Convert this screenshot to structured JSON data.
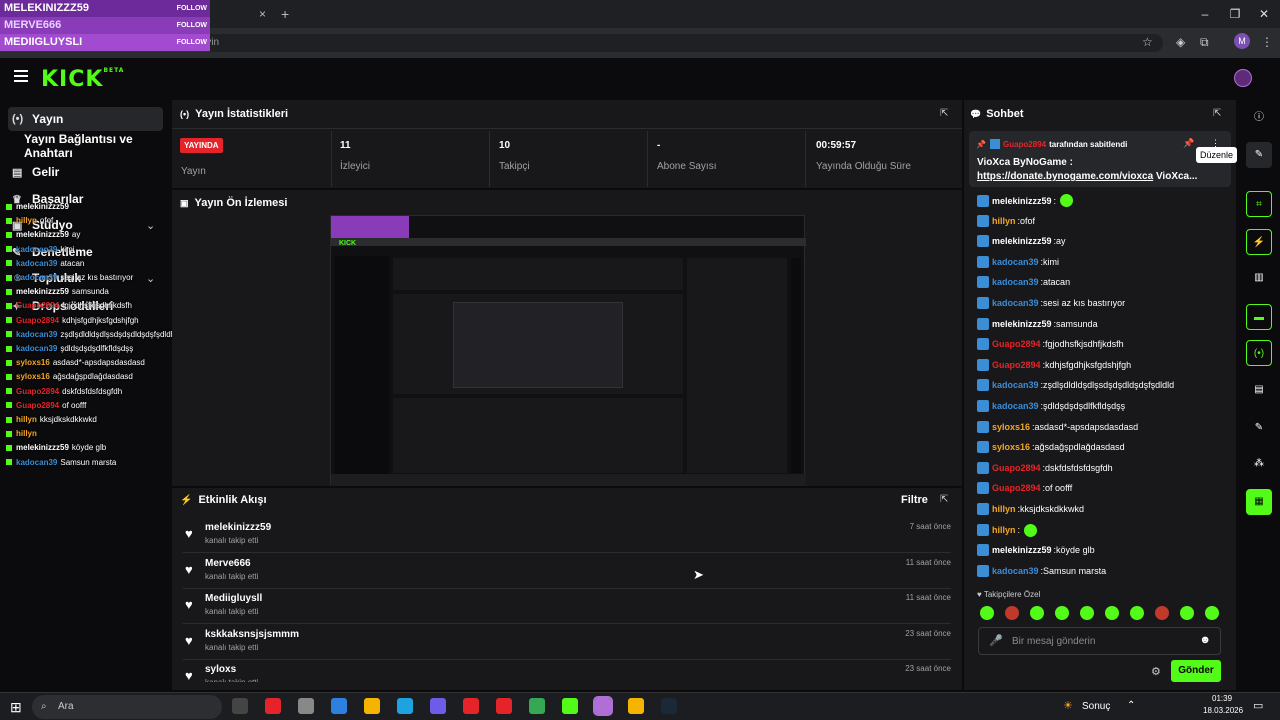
{
  "browser": {
    "url": "dashboard.kick.com/yayin",
    "tab_close": "×",
    "new_tab": "+",
    "profile_initial": "M"
  },
  "follow_alert": {
    "lines": [
      "MELEKINIZZZ59",
      "MERVE666",
      "MEDIIGLUYSLI"
    ],
    "follow_label": "FOLLOW"
  },
  "kick": {
    "logo": "KICK",
    "beta": "BETA",
    "brand_color": "#53fc18"
  },
  "sidebar": {
    "items": [
      {
        "label": "Yayın",
        "icon": "broadcast-icon"
      },
      {
        "label": "Yayın Bağlantısı ve Anahtarı",
        "icon": ""
      },
      {
        "label": "Gelir",
        "icon": "dollar-icon"
      },
      {
        "label": "Başarılar",
        "icon": "trophy-icon"
      },
      {
        "label": "Stüdyo",
        "icon": "studio-icon"
      },
      {
        "label": "Denetleme",
        "icon": "wrench-icon"
      },
      {
        "label": "Topluluk",
        "icon": "community-icon"
      },
      {
        "label": "Drops ödülleri",
        "icon": "gift-icon"
      }
    ]
  },
  "overlay_chat": [
    {
      "user": "melekinizzz59",
      "msg": "",
      "color": "#ffffff"
    },
    {
      "user": "hillyn",
      "msg": "ofof",
      "color": "#f5a623"
    },
    {
      "user": "melekinizzz59",
      "msg": "ay",
      "color": "#ffffff"
    },
    {
      "user": "kadocan39",
      "msg": "kimi",
      "color": "#3b8dd6"
    },
    {
      "user": "kadocan39",
      "msg": "atacan",
      "color": "#3b8dd6"
    },
    {
      "user": "kadocan39",
      "msg": "sesi az kıs bastırıyor",
      "color": "#3b8dd6"
    },
    {
      "user": "melekinizzz59",
      "msg": "samsunda",
      "color": "#ffffff"
    },
    {
      "user": "Guapo2894",
      "msg": "fgjodhsfkjsdhfjkdsfh",
      "color": "#e5242a"
    },
    {
      "user": "Guapo2894",
      "msg": "kdhjsfgdhjksfgdshjfgh",
      "color": "#e5242a"
    },
    {
      "user": "kadocan39",
      "msg": "zşdlşdldldşdlşsdşdşdldşdşfşdldld",
      "color": "#3b8dd6"
    },
    {
      "user": "kadocan39",
      "msg": "şdldşdşdşdlfkfldşdşş",
      "color": "#3b8dd6"
    },
    {
      "user": "syloxs16",
      "msg": "asdasd*-apsdapsdasdasd",
      "color": "#f5a623"
    },
    {
      "user": "syloxs16",
      "msg": "ağsdağşpdlağdasdasd",
      "color": "#f5a623"
    },
    {
      "user": "Guapo2894",
      "msg": "dskfdsfdsfdsgfdh",
      "color": "#e5242a"
    },
    {
      "user": "Guapo2894",
      "msg": "of oofff",
      "color": "#e5242a"
    },
    {
      "user": "hillyn",
      "msg": "kksjdkskdkkwkd",
      "color": "#f5a623"
    },
    {
      "user": "hillyn",
      "msg": "",
      "color": "#f5a623"
    },
    {
      "user": "melekinizzz59",
      "msg": "köyde glb",
      "color": "#ffffff"
    },
    {
      "user": "kadocan39",
      "msg": "Samsun marsta",
      "color": "#3b8dd6"
    }
  ],
  "stats": {
    "title": "Yayın İstatistikleri",
    "live_badge": "YAYINDA",
    "cols": [
      {
        "value": "",
        "label": "Yayın"
      },
      {
        "value": "11",
        "label": "İzleyici"
      },
      {
        "value": "10",
        "label": "Takipçi"
      },
      {
        "value": "-",
        "label": "Abone Sayısı"
      },
      {
        "value": "00:59:57",
        "label": "Yayında Olduğu Süre"
      }
    ]
  },
  "preview": {
    "title": "Yayın Ön İzlemesi"
  },
  "events": {
    "title": "Etkinlik Akışı",
    "filter": "Filtre",
    "rows": [
      {
        "name": "melekinizzz59",
        "action": "kanalı takip etti",
        "time": "7 saat önce"
      },
      {
        "name": "Merve666",
        "action": "kanalı takip etti",
        "time": "11 saat önce"
      },
      {
        "name": "Mediigluysll",
        "action": "kanalı takip etti",
        "time": "11 saat önce"
      },
      {
        "name": "kskkaksnsjsjsmmm",
        "action": "kanalı takip etti",
        "time": "23 saat önce"
      },
      {
        "name": "syloxs",
        "action": "kanalı takip etti",
        "time": "23 saat önce"
      }
    ]
  },
  "chat": {
    "title": "Sohbet",
    "pinned_by_user": "Guapo2894",
    "pinned_by_text": "tarafından sabitlendi",
    "pinned_title": "VioXca ByNoGame :",
    "pinned_link": "https://donate.bynogame.com/vioxca",
    "pinned_suffix": "VioXca...",
    "tooltip": "Düzenle",
    "messages": [
      {
        "user": "melekinizzz59",
        "msg": "",
        "color": "#ffffff",
        "emote": true
      },
      {
        "user": "hillyn",
        "msg": "ofof",
        "color": "#f5a623"
      },
      {
        "user": "melekinizzz59",
        "msg": "ay",
        "color": "#ffffff"
      },
      {
        "user": "kadocan39",
        "msg": "kimi",
        "color": "#3b8dd6"
      },
      {
        "user": "kadocan39",
        "msg": "atacan",
        "color": "#3b8dd6"
      },
      {
        "user": "kadocan39",
        "msg": "sesi az kıs bastırıyor",
        "color": "#3b8dd6"
      },
      {
        "user": "melekinizzz59",
        "msg": "samsunda",
        "color": "#ffffff"
      },
      {
        "user": "Guapo2894",
        "msg": "fgjodhsfkjsdhfjkdsfh",
        "color": "#e5242a"
      },
      {
        "user": "Guapo2894",
        "msg": "kdhjsfgdhjksfgdshjfgh",
        "color": "#e5242a"
      },
      {
        "user": "kadocan39",
        "msg": "zşdlşdldldşdlşsdşdşdldşdşfşdldld",
        "color": "#3b8dd6"
      },
      {
        "user": "kadocan39",
        "msg": "şdldşdşdşdlfkfldşdşş",
        "color": "#3b8dd6"
      },
      {
        "user": "syloxs16",
        "msg": "asdasd*-apsdapsdasdasd",
        "color": "#f5a623"
      },
      {
        "user": "syloxs16",
        "msg": "ağsdağşpdlağdasdasd",
        "color": "#f5a623"
      },
      {
        "user": "Guapo2894",
        "msg": "dskfdsfdsfdsgfdh",
        "color": "#e5242a"
      },
      {
        "user": "Guapo2894",
        "msg": "of oofff",
        "color": "#e5242a"
      },
      {
        "user": "hillyn",
        "msg": "kksjdkskdkkwkd",
        "color": "#f5a623"
      },
      {
        "user": "hillyn",
        "msg": "",
        "color": "#f5a623",
        "emote": true
      },
      {
        "user": "melekinizzz59",
        "msg": "köyde glb",
        "color": "#ffffff"
      },
      {
        "user": "kadocan39",
        "msg": "Samsun marsta",
        "color": "#3b8dd6"
      }
    ],
    "followers_only": "Takipçilere Özel",
    "input_placeholder": "Bir mesaj gönderin",
    "send": "Gönder"
  },
  "taskbar": {
    "search_placeholder": "Ara",
    "weather": "Sonuç",
    "time": "01:39",
    "date": "18.03.2026"
  }
}
